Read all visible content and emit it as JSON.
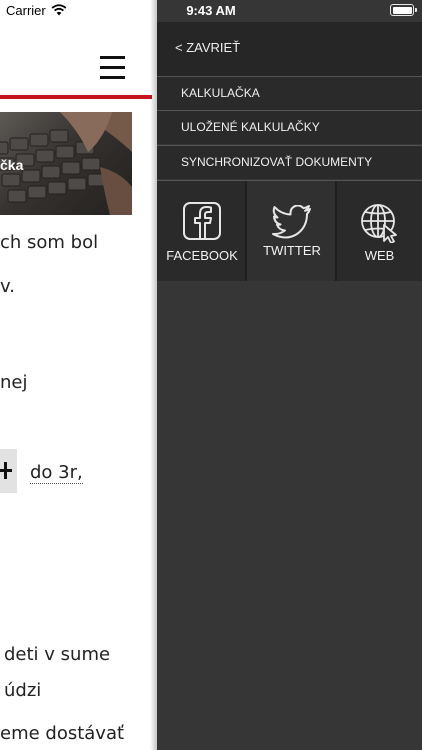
{
  "status_bar": {
    "carrier": "Carrier",
    "time": "9:43 AM"
  },
  "page": {
    "hero_title": "čka",
    "lines": [
      "ch som bol",
      "v.",
      "nej",
      "do 3r,",
      "deti v sume",
      "údzi",
      "eme dostávať"
    ]
  },
  "menu": {
    "close_label": "< ZAVRIEŤ",
    "items": [
      {
        "label": "KALKULAČKA"
      },
      {
        "label": "ULOŽENÉ KALKULAČKY"
      },
      {
        "label": "SYNCHRONIZOVAŤ DOKUMENTY"
      }
    ],
    "social": [
      {
        "label": "FACEBOOK",
        "icon": "facebook-icon"
      },
      {
        "label": "TWITTER",
        "icon": "twitter-icon"
      },
      {
        "label": "WEB",
        "icon": "globe-cursor-icon"
      }
    ]
  },
  "colors": {
    "accent_red": "#c4161c",
    "menu_bg": "#363636",
    "menu_item_bg": "#2a2a2a"
  }
}
